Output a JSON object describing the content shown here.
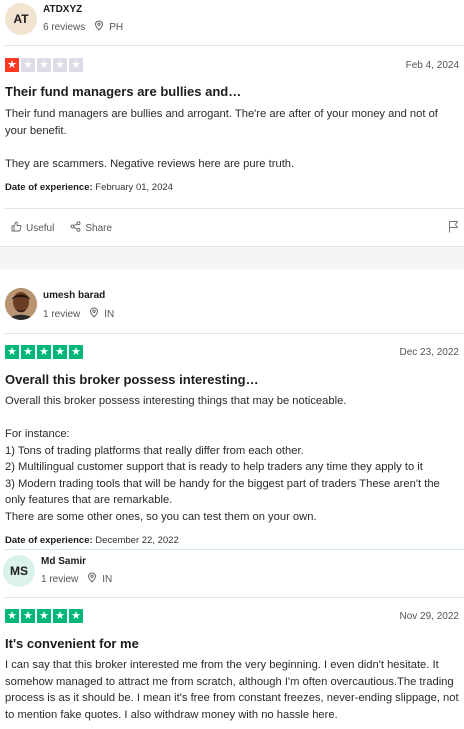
{
  "colors": {
    "star_red": "#ff3722",
    "star_green": "#00b67a",
    "star_empty": "#dcdce6",
    "avatar_at_bg": "#f3e4d2",
    "avatar_ms_bg": "#dbf2e8"
  },
  "reviews": [
    {
      "reviewer": {
        "initials": "AT",
        "name": "ATDXYZ",
        "review_count": "6 reviews",
        "country": "PH"
      },
      "rating": 1,
      "date": "Feb 4, 2024",
      "title": "Their fund managers are bullies and…",
      "body": "Their fund managers are bullies and arrogant. The're are after of your money and not of your benefit.\n\nThey are scammers. Negative reviews here are pure truth.",
      "experience_label": "Date of experience:",
      "experience_date": "February 01, 2024",
      "actions": {
        "useful": "Useful",
        "share": "Share"
      }
    },
    {
      "reviewer": {
        "name": "umesh barad",
        "review_count": "1 review",
        "country": "IN"
      },
      "rating": 5,
      "date": "Dec 23, 2022",
      "title": "Overall this broker possess interesting…",
      "body": "Overall this broker possess interesting things that may be noticeable.\n\nFor instance:\n1) Tons of trading platforms that really differ from each other.\n2) Multilingual customer support that is ready to help traders any time they apply to it\n3) Modern trading tools that will be handy for the biggest part of traders These aren't the only features that are remarkable.\nThere are some other ones, so you can test them on your own.",
      "experience_label": "Date of experience:",
      "experience_date": "December 22, 2022"
    },
    {
      "reviewer": {
        "initials": "MS",
        "name": "Md Samir",
        "review_count": "1 review",
        "country": "IN"
      },
      "rating": 5,
      "date": "Nov 29, 2022",
      "title": "It's convenient for me",
      "body": "I can say that this broker interested me from the very beginning. I even didn't hesitate. It somehow managed to attract me from scratch, although I'm often overcautious.The trading process is as it should be. I mean it's free from constant freezes, never-ending slippage, not to mention fake quotes. I also withdraw money with no hassle here."
    }
  ]
}
